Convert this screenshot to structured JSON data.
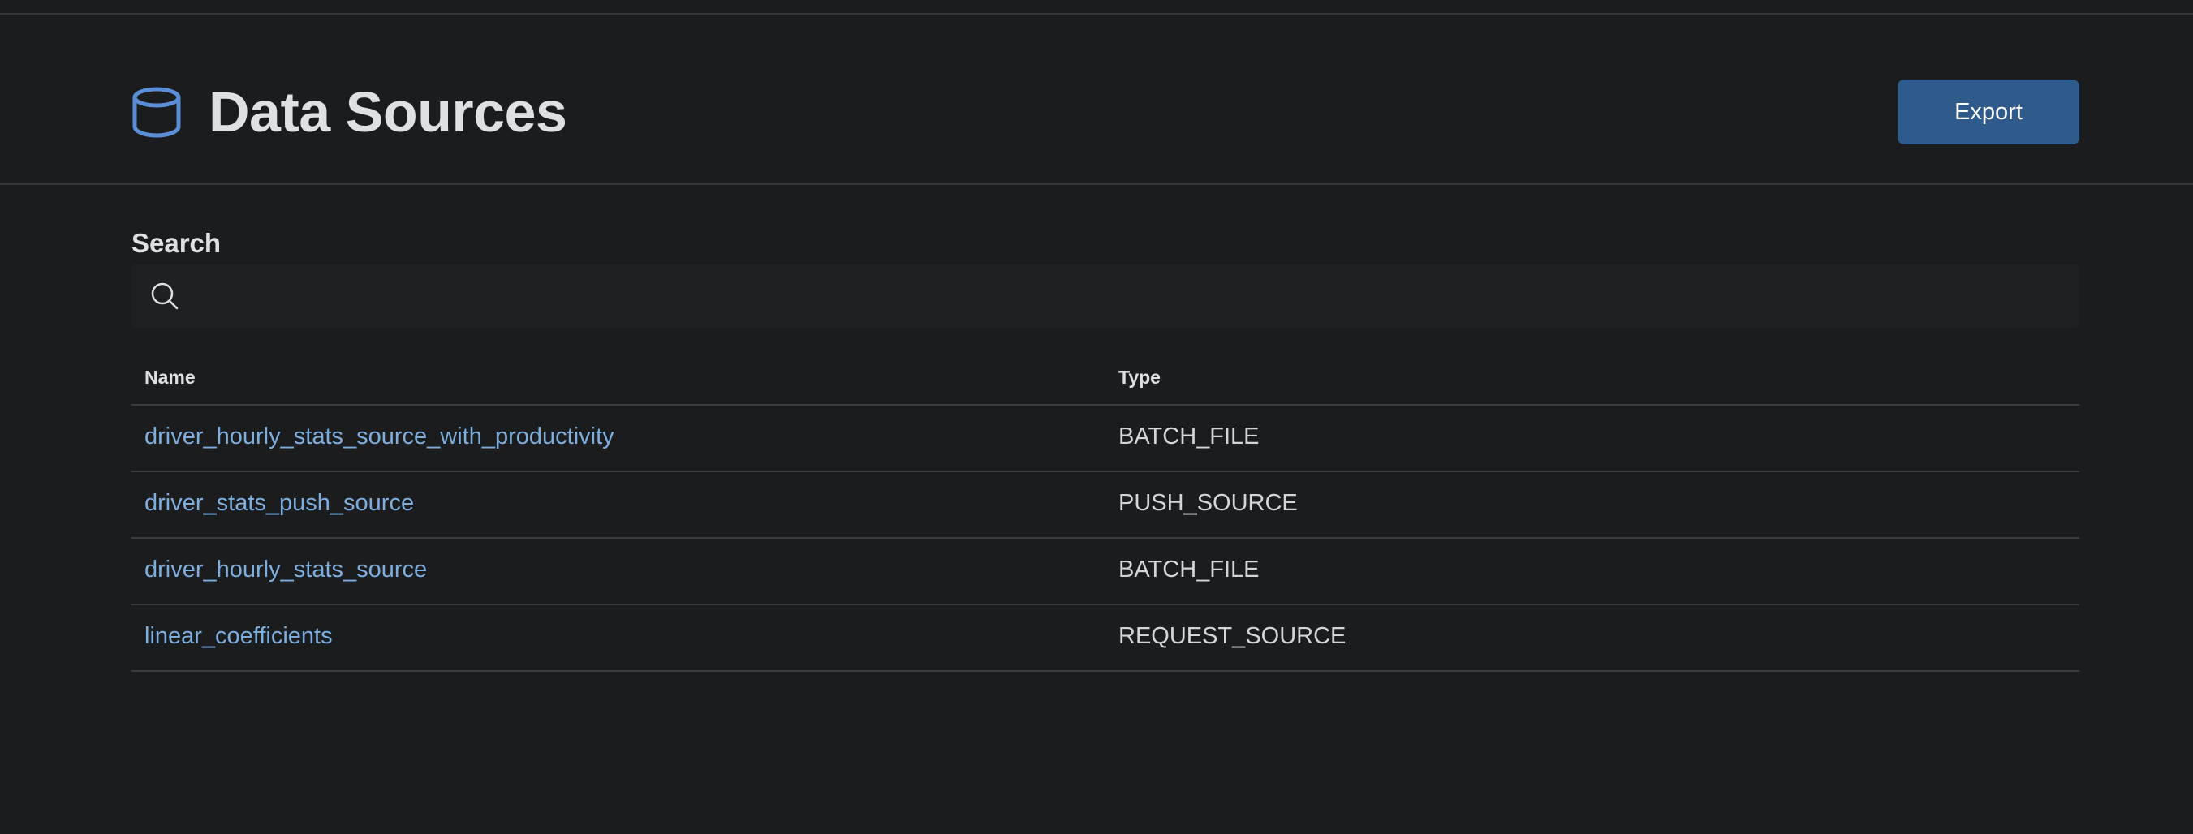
{
  "header": {
    "title": "Data Sources",
    "icon": "database-icon",
    "export_label": "Export"
  },
  "search": {
    "label": "Search",
    "value": "",
    "placeholder": ""
  },
  "table": {
    "columns": [
      "Name",
      "Type"
    ],
    "rows": [
      {
        "name": "driver_hourly_stats_source_with_productivity",
        "type": "BATCH_FILE"
      },
      {
        "name": "driver_stats_push_source",
        "type": "PUSH_SOURCE"
      },
      {
        "name": "driver_hourly_stats_source",
        "type": "BATCH_FILE"
      },
      {
        "name": "linear_coefficients",
        "type": "REQUEST_SOURCE"
      }
    ]
  },
  "colors": {
    "background": "#1b1c1e",
    "accent": "#2e5b8b",
    "link": "#7eaedd",
    "icon": "#5b8ed6"
  }
}
